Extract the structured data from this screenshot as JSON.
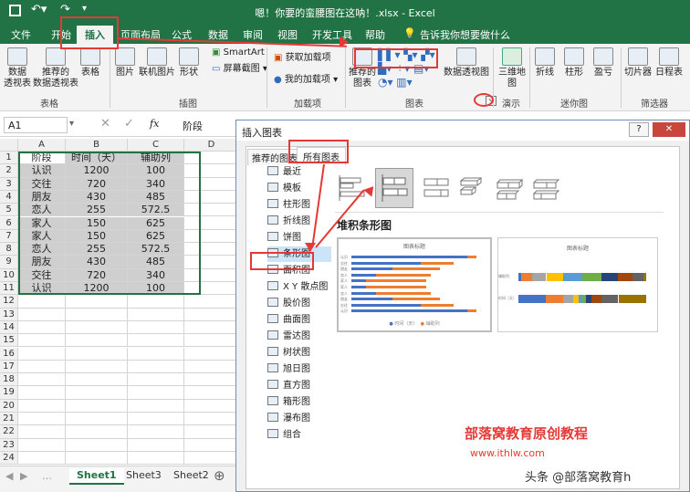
{
  "window": {
    "title": "嗯！你要的蛮腰图在这呐！.xlsx - Excel"
  },
  "ribbon_tabs": [
    "文件",
    "开始",
    "插入",
    "页面布局",
    "公式",
    "数据",
    "审阅",
    "视图",
    "开发工具",
    "帮助"
  ],
  "tell_me": "告诉我你想要做什么",
  "ribbon": {
    "pivot_table": "数据\n透视表",
    "recommended_pivot": "推荐的\n数据透视表",
    "table": "表格",
    "tables_group": "表格",
    "picture": "图片",
    "online_picture": "联机图片",
    "shapes": "形状",
    "smartart": "SmartArt",
    "screenshot": "屏幕截图",
    "illustrations_group": "插图",
    "get_addins": "获取加载项",
    "my_addins": "我的加载项",
    "addins_group": "加载项",
    "recommended_charts": "推荐的\n图表",
    "pivot_chart": "数据透视图",
    "charts_group": "图表",
    "map_3d": "三维地\n图",
    "tours_group": "演示",
    "line": "折线",
    "column": "柱形",
    "winloss": "盈亏",
    "sparklines_group": "迷你图",
    "slicer": "切片器",
    "timeline": "日程表",
    "filters_group": "筛选器"
  },
  "formula_bar": {
    "name_box": "A1",
    "fx": "fx",
    "value": "阶段"
  },
  "columns": [
    "A",
    "B",
    "C",
    "D"
  ],
  "rows": [
    "1",
    "2",
    "3",
    "4",
    "5",
    "6",
    "7",
    "8",
    "9",
    "10",
    "11",
    "12",
    "13",
    "14",
    "15",
    "16",
    "17",
    "18",
    "19",
    "20",
    "21",
    "22",
    "23",
    "24"
  ],
  "table": {
    "headers": [
      "阶段",
      "时间（天）",
      "辅助列"
    ],
    "data": [
      [
        "认识",
        "1200",
        "100"
      ],
      [
        "交往",
        "720",
        "340"
      ],
      [
        "朋友",
        "430",
        "485"
      ],
      [
        "恋人",
        "255",
        "572.5"
      ],
      [
        "家人",
        "150",
        "625"
      ],
      [
        "家人",
        "150",
        "625"
      ],
      [
        "恋人",
        "255",
        "572.5"
      ],
      [
        "朋友",
        "430",
        "485"
      ],
      [
        "交往",
        "720",
        "340"
      ],
      [
        "认识",
        "1200",
        "100"
      ]
    ]
  },
  "sheet_tabs": [
    "Sheet1",
    "Sheet3",
    "Sheet2"
  ],
  "dialog": {
    "title": "插入图表",
    "help": "?",
    "close": "✕",
    "tabs": [
      "推荐的图表",
      "所有图表"
    ],
    "chart_types": [
      "最近",
      "模板",
      "柱形图",
      "折线图",
      "饼图",
      "条形图",
      "面积图",
      "X Y 散点图",
      "股价图",
      "曲面图",
      "雷达图",
      "树状图",
      "旭日图",
      "直方图",
      "箱形图",
      "瀑布图",
      "组合"
    ],
    "selected_subtype": "堆积条形图",
    "preview_title": "图表标题"
  },
  "watermark": {
    "line1": "部落窝教育原创教程",
    "line2": "www.ithlw.com",
    "brand": "头条 @部落窝教育h"
  },
  "colors": {
    "excel_green": "#217346",
    "red_annotation": "#e53935",
    "bar_blue": "#4472c4",
    "bar_orange": "#ed7d31",
    "selection": "#cfcfcf"
  }
}
